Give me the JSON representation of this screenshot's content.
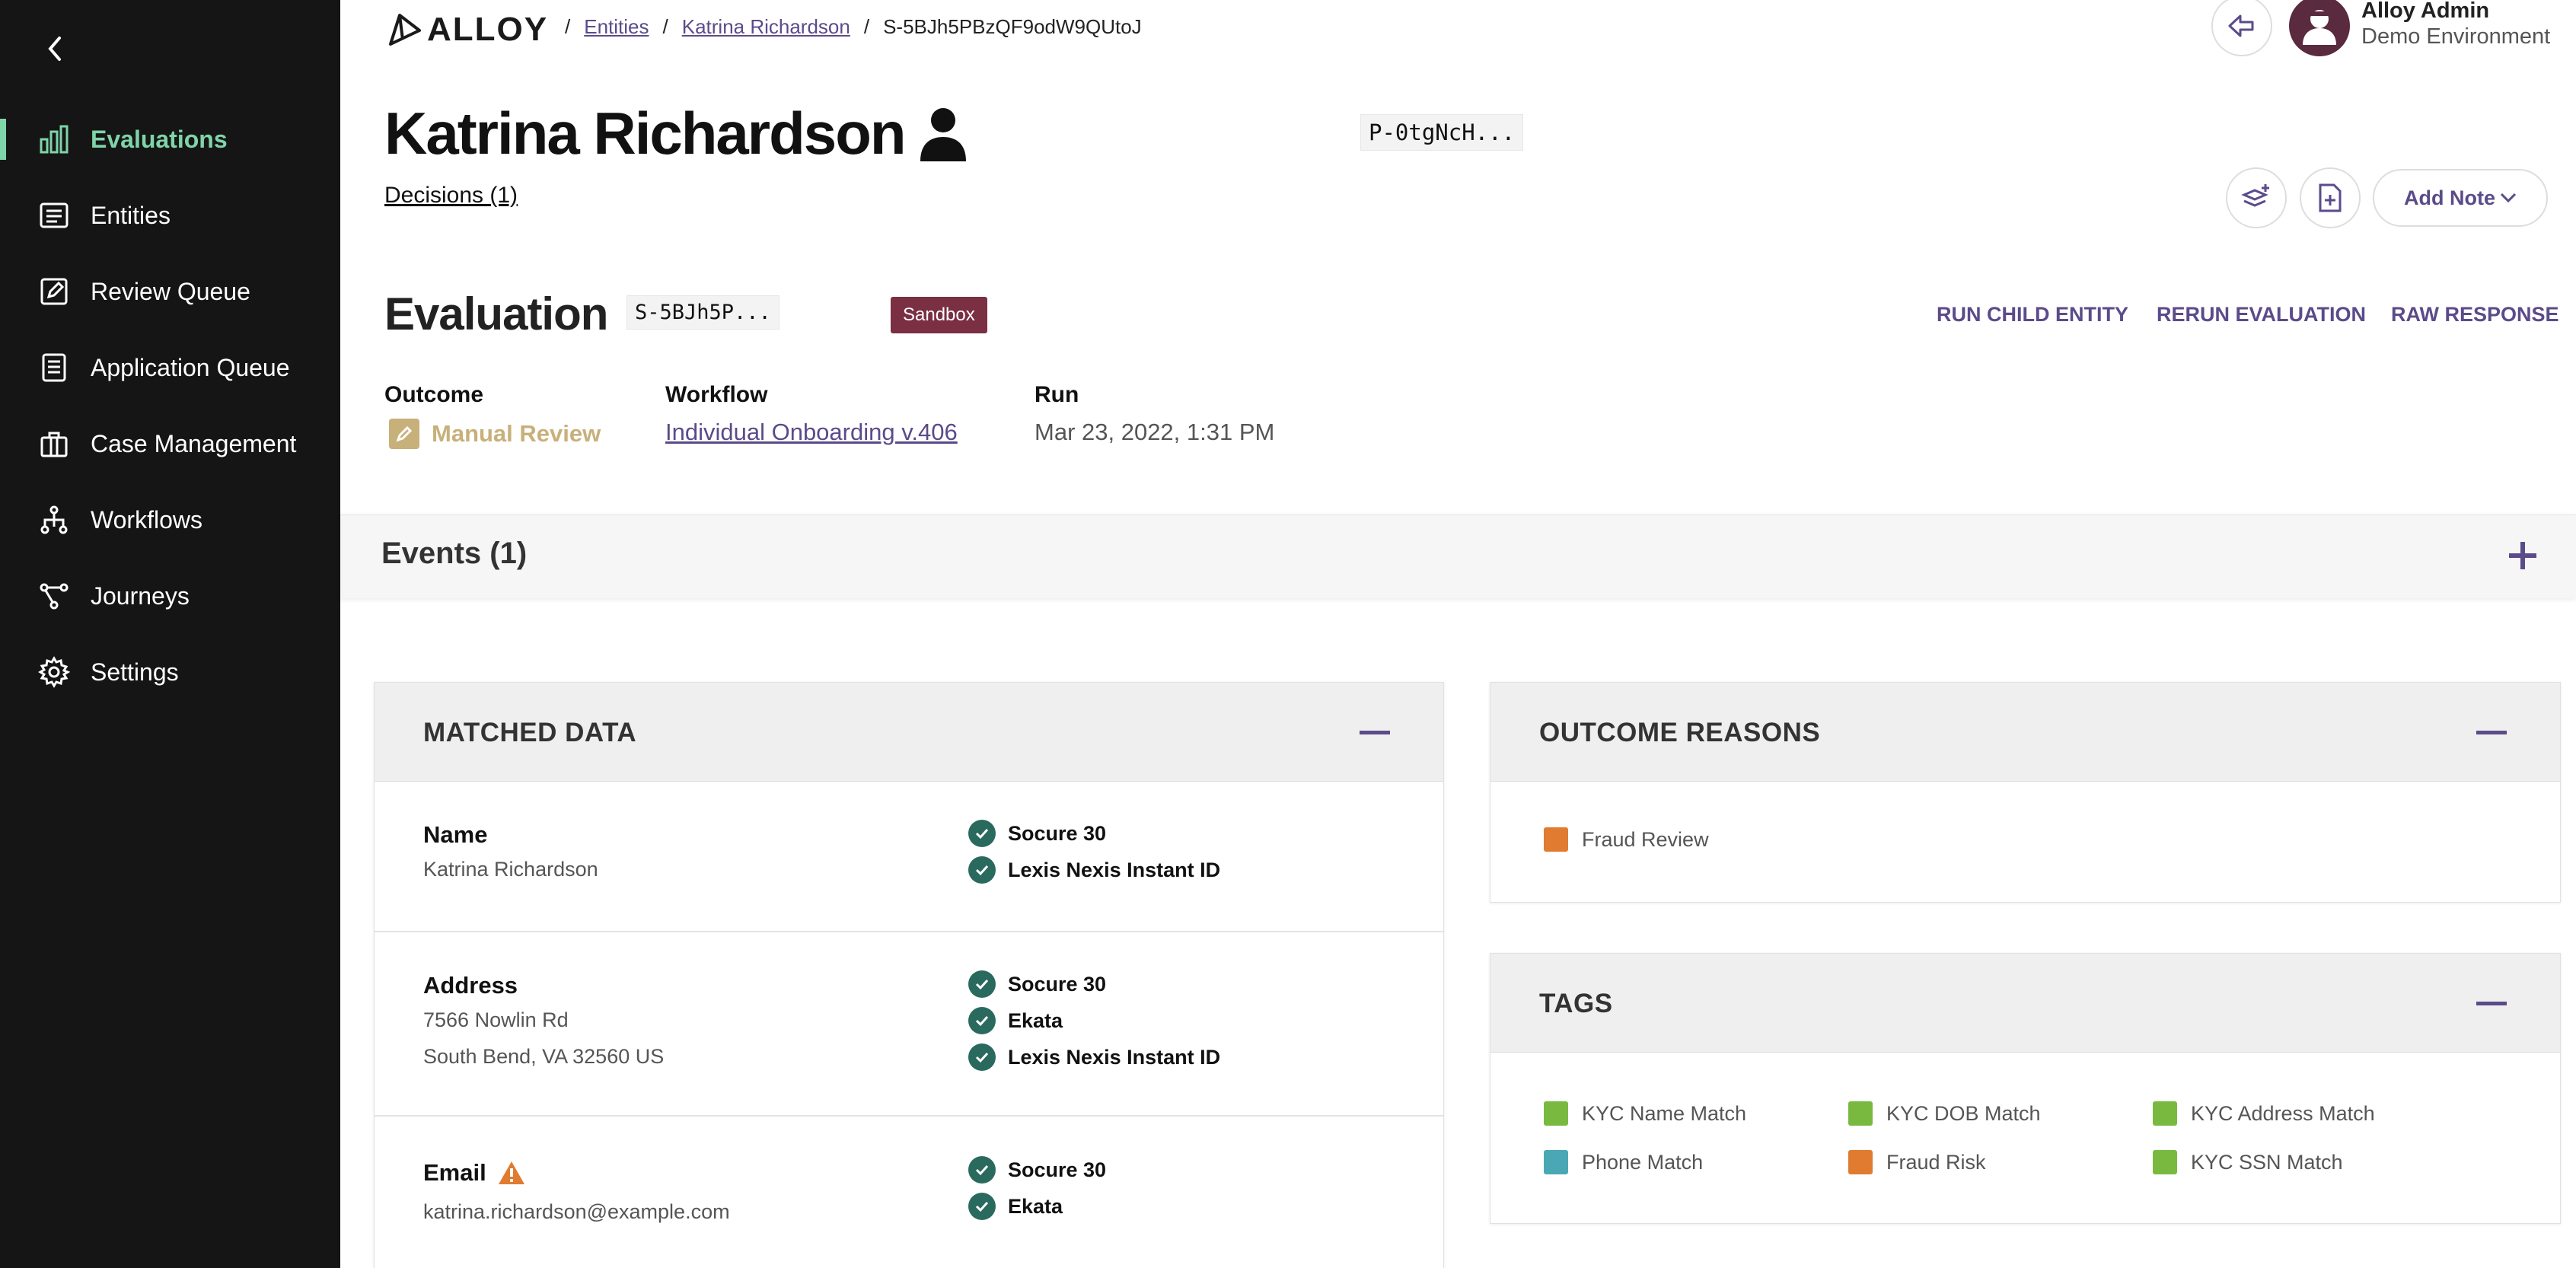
{
  "sidebar": {
    "back_icon": "chevron-left-icon",
    "items": [
      {
        "label": "Evaluations",
        "icon": "bar-chart-icon",
        "active": true
      },
      {
        "label": "Entities",
        "icon": "entities-icon"
      },
      {
        "label": "Review Queue",
        "icon": "edit-icon"
      },
      {
        "label": "Application Queue",
        "icon": "document-icon"
      },
      {
        "label": "Case Management",
        "icon": "briefcase-icon"
      },
      {
        "label": "Workflows",
        "icon": "workflow-icon"
      },
      {
        "label": "Journeys",
        "icon": "journey-icon"
      },
      {
        "label": "Settings",
        "icon": "gear-icon"
      }
    ],
    "accent_color": "#7fd4a8"
  },
  "header": {
    "logo": "ALLOY",
    "breadcrumb": {
      "sep": "/",
      "entities": "Entities",
      "person": "Katrina Richardson",
      "current": "S-5BJh5PBzQF9odW9QUtoJ"
    },
    "user": {
      "name": "Alloy Admin",
      "environment": "Demo Environment"
    }
  },
  "entity": {
    "name": "Katrina Richardson",
    "id_short": "P-0tgNcH...",
    "decisions_link": "Decisions (1)",
    "add_note": "Add Note"
  },
  "evaluation": {
    "title": "Evaluation",
    "id_short": "S-5BJh5P...",
    "badge": "Sandbox",
    "badge_color": "#7b2f43",
    "actions": {
      "run_child": "RUN CHILD ENTITY",
      "rerun": "RERUN EVALUATION",
      "raw": "RAW RESPONSE"
    },
    "outcome_label": "Outcome",
    "outcome_value": "Manual Review",
    "workflow_label": "Workflow",
    "workflow_value": "Individual Onboarding v.406",
    "run_label": "Run",
    "run_value": "Mar 23, 2022, 1:31 PM"
  },
  "events": {
    "title": "Events (1)"
  },
  "matched_data": {
    "title": "MATCHED DATA",
    "rows": [
      {
        "label": "Name",
        "values": [
          "Katrina Richardson"
        ],
        "sources": [
          "Socure 30",
          "Lexis Nexis Instant ID"
        ]
      },
      {
        "label": "Address",
        "values": [
          "7566 Nowlin Rd",
          "South Bend, VA 32560 US"
        ],
        "sources": [
          "Socure 30",
          "Ekata",
          "Lexis Nexis Instant ID"
        ]
      },
      {
        "label": "Email",
        "values": [
          "katrina.richardson@example.com"
        ],
        "sources": [
          "Socure 30",
          "Ekata"
        ],
        "warning": true
      }
    ]
  },
  "outcome_reasons": {
    "title": "OUTCOME REASONS",
    "items": [
      {
        "label": "Fraud Review",
        "color": "#e07b2f"
      }
    ]
  },
  "tags": {
    "title": "TAGS",
    "items": [
      {
        "label": "KYC Name Match",
        "color": "#7ab940"
      },
      {
        "label": "KYC DOB Match",
        "color": "#7ab940"
      },
      {
        "label": "KYC Address Match",
        "color": "#7ab940"
      },
      {
        "label": "Phone Match",
        "color": "#4aa8b4"
      },
      {
        "label": "Fraud Risk",
        "color": "#e07b2f"
      },
      {
        "label": "KYC SSN Match",
        "color": "#7ab940"
      }
    ]
  }
}
